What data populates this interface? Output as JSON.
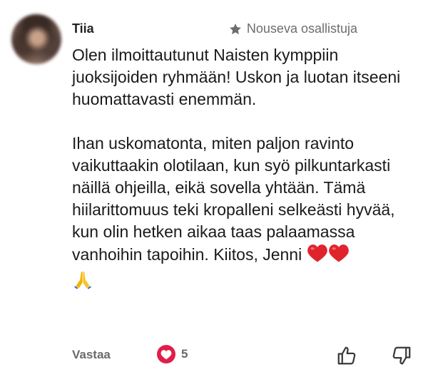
{
  "comment": {
    "author": "Tiia",
    "badge": {
      "icon": "star-icon",
      "label": "Nouseva osallistuja"
    },
    "paragraphs": [
      "Olen ilmoittautunut Naisten kymppiin juoksijoiden ryhmään! Uskon ja luotan itseeni huomattavasti enemmän.",
      "Ihan uskomatonta, miten paljon ravinto vaikuttaakin olotilaan, kun syö pilkuntarkasti näillä ohjeilla, eikä sovella yhtään. Tämä hiilarittomuus teki kropalleni selkeästi hyvää, kun olin hetken aikaa taas palaamassa vanhoihin tapoihin. Kiitos, Jenni"
    ],
    "emojis": [
      "red-heart-icon",
      "red-heart-icon",
      "folded-hands-icon"
    ],
    "actions": {
      "reply_label": "Vastaa",
      "like_count": "5",
      "like_icon": "heart-icon",
      "thumb_up_icon": "thumbs-up-icon",
      "thumb_down_icon": "thumbs-down-icon"
    },
    "colors": {
      "heart_red": "#e11d48",
      "muted_text": "#6a6a6a",
      "body_text": "#1a1a1a"
    }
  }
}
